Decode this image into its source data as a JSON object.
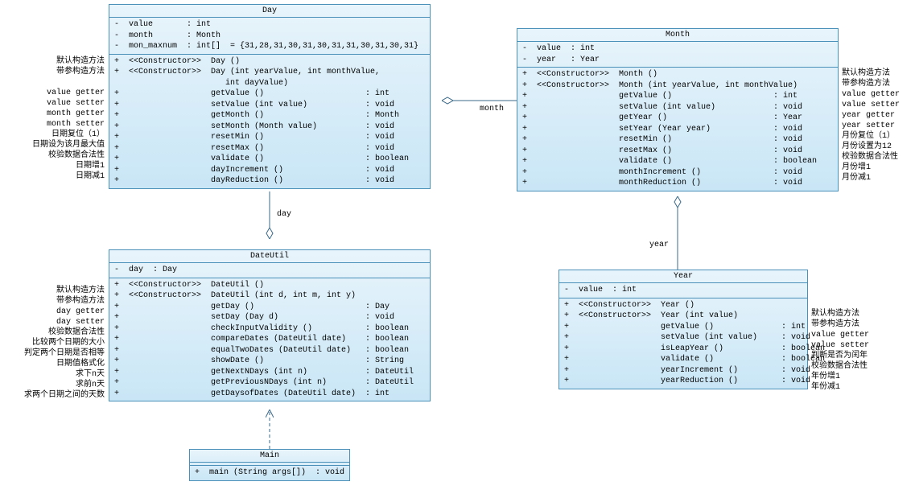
{
  "chart_data": {
    "type": "uml-class-diagram",
    "classes": [
      {
        "name": "Day",
        "attributes": [
          "value:int",
          "month:Month",
          "mon_maxnum:int[]"
        ],
        "methods": [
          "Day()",
          "Day(int,int,int)",
          "getValue():int",
          "setValue(int):void",
          "getMonth():Month",
          "setMonth(Month):void",
          "resetMin():void",
          "resetMax():void",
          "validate():boolean",
          "dayIncrement():void",
          "dayReduction():void"
        ]
      },
      {
        "name": "Month",
        "attributes": [
          "value:int",
          "year:Year"
        ],
        "methods": [
          "Month()",
          "Month(int,int)",
          "getValue():int",
          "setValue(int):void",
          "getYear():Year",
          "setYear(Year):void",
          "resetMin():void",
          "resetMax():void",
          "validate():boolean",
          "monthIncrement():void",
          "monthReduction():void"
        ]
      },
      {
        "name": "DateUtil",
        "attributes": [
          "day:Day"
        ],
        "methods": [
          "DateUtil()",
          "DateUtil(int,int,int)",
          "getDay():Day",
          "setDay(Day):void",
          "checkInputValidity():boolean",
          "compareDates(DateUtil):boolean",
          "equalTwoDates(DateUtil):boolean",
          "showDate():String",
          "getNextNDays(int):DateUtil",
          "getPreviousNDays(int):DateUtil",
          "getDaysofDates(DateUtil):int"
        ]
      },
      {
        "name": "Year",
        "attributes": [
          "value:int"
        ],
        "methods": [
          "Year()",
          "Year(int)",
          "getValue():int",
          "setValue(int):void",
          "isLeapYear():boolean",
          "validate():boolean",
          "yearIncrement():void",
          "yearReduction():void"
        ]
      },
      {
        "name": "Main",
        "attributes": [],
        "methods": [
          "main(String[]):void"
        ]
      }
    ],
    "relations": [
      {
        "from": "Day",
        "to": "Month",
        "type": "aggregation",
        "label": "month"
      },
      {
        "from": "DateUtil",
        "to": "Day",
        "type": "aggregation",
        "label": "day"
      },
      {
        "from": "Month",
        "to": "Year",
        "type": "aggregation",
        "label": "year"
      },
      {
        "from": "Main",
        "to": "DateUtil",
        "type": "dependency"
      }
    ]
  },
  "day": {
    "title": "Day",
    "attrs": "-  value       : int\n-  month       : Month\n-  mon_maxnum  : int[]  = {31,28,31,30,31,30,31,31,30,31,30,31}",
    "ops": "+  <<Constructor>>  Day ()\n+  <<Constructor>>  Day (int yearValue, int monthValue,\n                       int dayValue)\n+                   getValue ()                     : int\n+                   setValue (int value)            : void\n+                   getMonth ()                     : Month\n+                   setMonth (Month value)          : void\n+                   resetMin ()                     : void\n+                   resetMax ()                     : void\n+                   validate ()                     : boolean\n+                   dayIncrement ()                 : void\n+                   dayReduction ()                 : void"
  },
  "month": {
    "title": "Month",
    "attrs": "-  value  : int\n-  year   : Year",
    "ops": "+  <<Constructor>>  Month ()\n+  <<Constructor>>  Month (int yearValue, int monthValue)\n+                   getValue ()                     : int\n+                   setValue (int value)            : void\n+                   getYear ()                      : Year\n+                   setYear (Year year)             : void\n+                   resetMin ()                     : void\n+                   resetMax ()                     : void\n+                   validate ()                     : boolean\n+                   monthIncrement ()               : void\n+                   monthReduction ()               : void"
  },
  "dateutil": {
    "title": "DateUtil",
    "attrs": "-  day  : Day",
    "ops": "+  <<Constructor>>  DateUtil ()\n+  <<Constructor>>  DateUtil (int d, int m, int y)\n+                   getDay ()                       : Day\n+                   setDay (Day d)                  : void\n+                   checkInputValidity ()           : boolean\n+                   compareDates (DateUtil date)    : boolean\n+                   equalTwoDates (DateUtil date)   : boolean\n+                   showDate ()                     : String\n+                   getNextNDays (int n)            : DateUtil\n+                   getPreviousNDays (int n)        : DateUtil\n+                   getDaysofDates (DateUtil date)  : int"
  },
  "year": {
    "title": "Year",
    "attrs": "-  value  : int",
    "ops": "+  <<Constructor>>  Year ()\n+  <<Constructor>>  Year (int value)\n+                   getValue ()              : int\n+                   setValue (int value)     : void\n+                   isLeapYear ()            : boolean\n+                   validate ()              : boolean\n+                   yearIncrement ()         : void\n+                   yearReduction ()         : void"
  },
  "main": {
    "title": "Main",
    "ops": "+  main (String args[])  : void"
  },
  "ann_day": "默认构造方法\n带参构造方法\n\nvalue getter\nvalue setter\nmonth getter\nmonth setter\n日期复位（1）\n日期设为该月最大值\n校验数据合法性\n日期增1\n日期减1",
  "ann_month": "默认构造方法\n带参构造方法\nvalue getter\nvalue setter\nyear getter\nyear setter\n月份复位（1）\n月份设置为12\n校验数据合法性\n月份增1\n月份减1",
  "ann_dateutil": "默认构造方法\n带参构造方法\nday getter\nday setter\n校验数据合法性\n比较两个日期的大小\n判定两个日期是否相等\n日期值格式化\n求下n天\n求前n天\n求两个日期之间的天数",
  "ann_year": "默认构造方法\n带参构造方法\nvalue getter\nvalue setter\n判断是否为闰年\n校验数据合法性\n年份增1\n年份减1",
  "lbl_month": "month",
  "lbl_day": "day",
  "lbl_year": "year"
}
